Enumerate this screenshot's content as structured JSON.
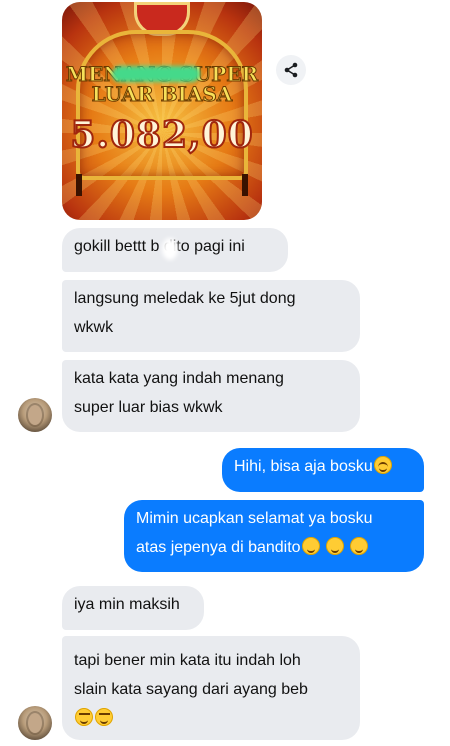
{
  "image_message": {
    "banner_line1": "MENANG SUPER",
    "banner_line2": "LUAR BIASA",
    "amount": "5.082,00"
  },
  "share_button": {
    "icon": "share-icon"
  },
  "messages": [
    {
      "side": "incoming",
      "text": "gokill bettt b    dito pagi ini"
    },
    {
      "side": "incoming",
      "line1": "langsung meledak ke 5jut dong",
      "line2": "wkwk"
    },
    {
      "side": "incoming",
      "line1": "kata kata yang indah menang",
      "line2": "super luar bias wkwk"
    },
    {
      "side": "outgoing",
      "text": "Hihi, bisa aja bosku",
      "emoji": "smiling-blush-emoji"
    },
    {
      "side": "outgoing",
      "line1": "Mimin ucapkan selamat ya bosku",
      "line2": "atas jepenya di bandito",
      "emoji": "star-struck-emoji"
    },
    {
      "side": "incoming",
      "text": "iya min maksih"
    },
    {
      "side": "incoming",
      "line1": "tapi bener min kata itu indah loh",
      "line2": "slain kata sayang dari ayang beb",
      "emoji": "rolling-laughing-emoji"
    }
  ],
  "colors": {
    "incoming_bubble": "#e9ebef",
    "outgoing_bubble": "#0a7cff"
  }
}
